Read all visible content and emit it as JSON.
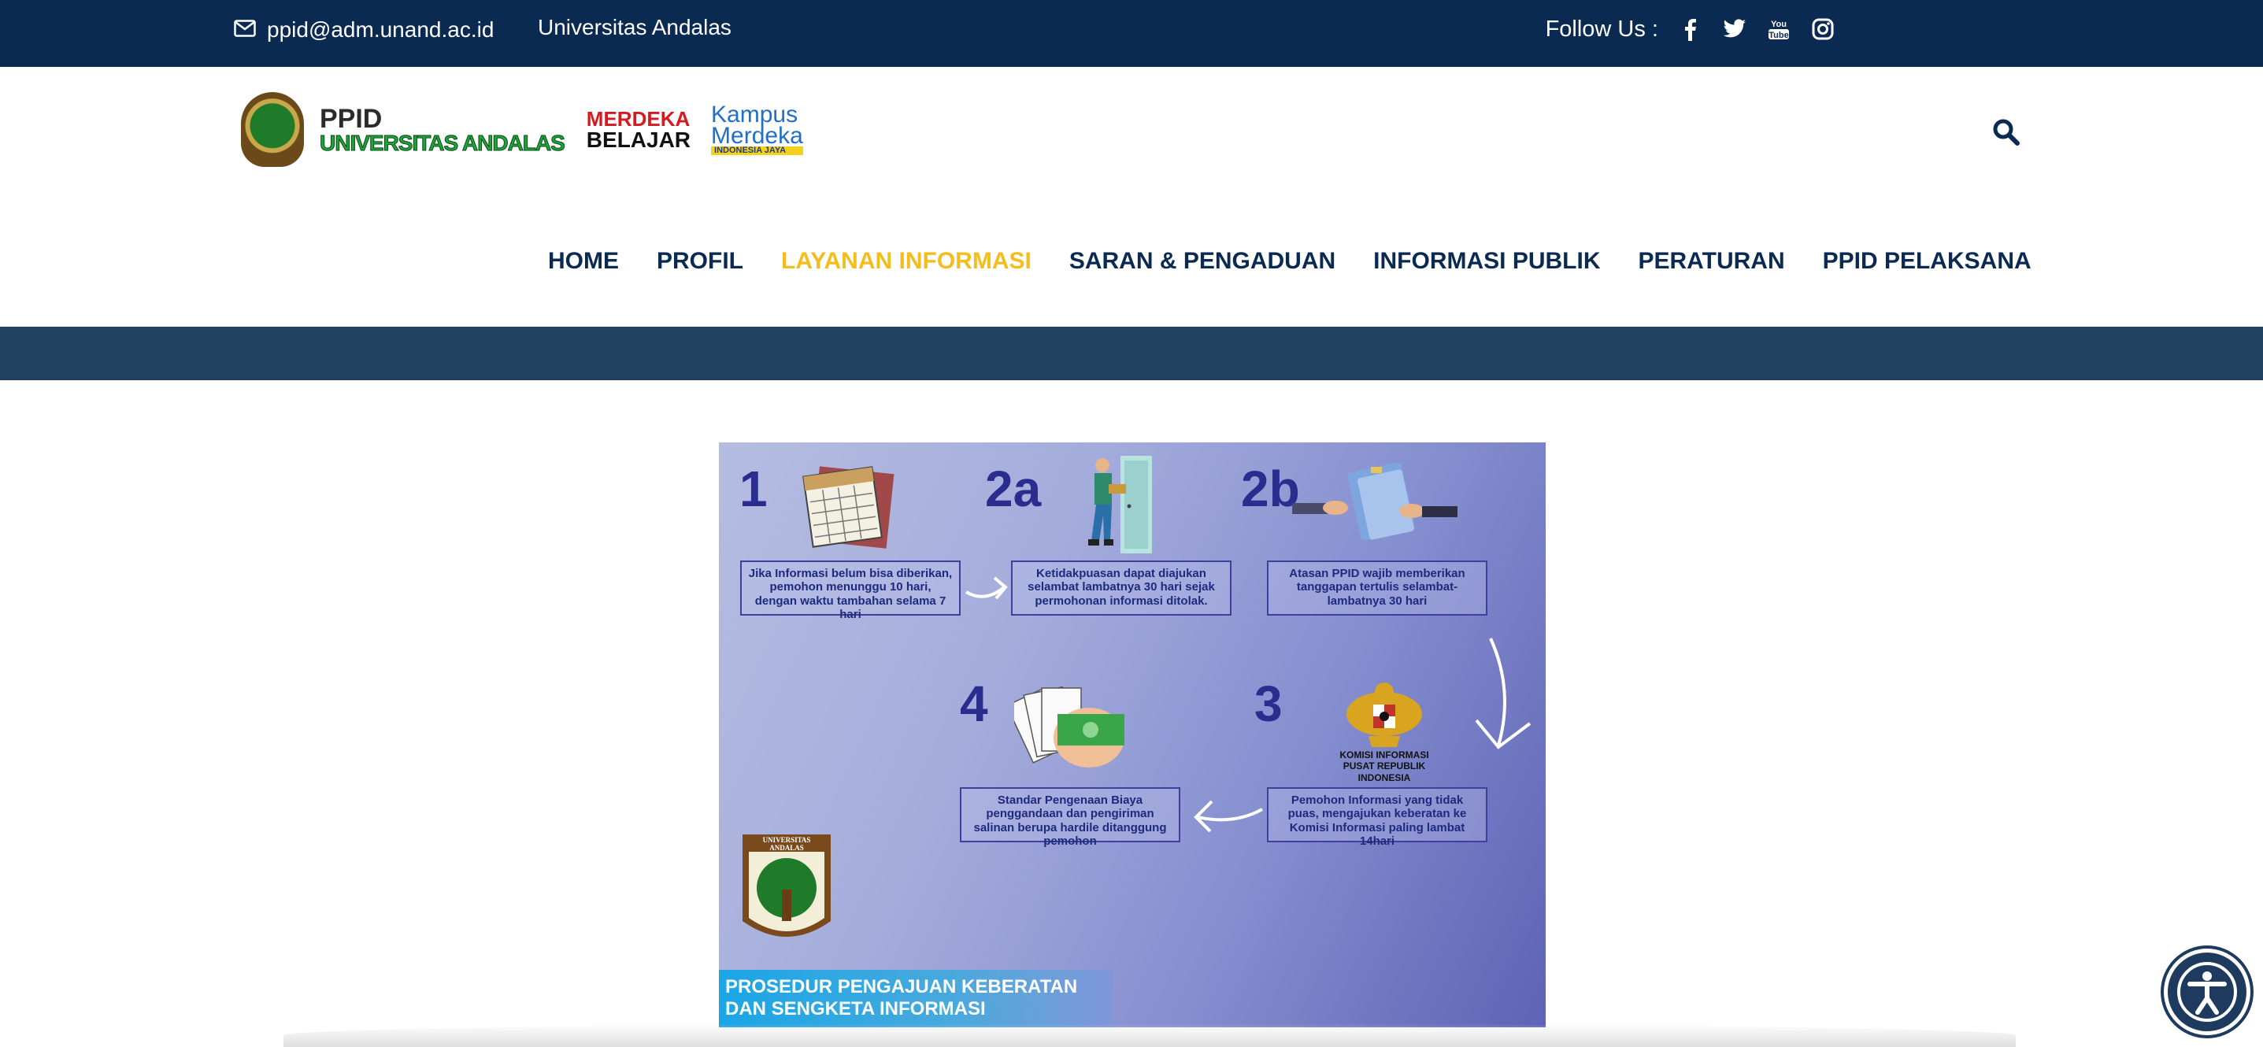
{
  "topbar": {
    "email": "ppid@adm.unand.ac.id",
    "site_name": "Universitas Andalas",
    "follow_label": "Follow Us :",
    "social": [
      "facebook-icon",
      "twitter-icon",
      "youtube-icon",
      "instagram-icon"
    ],
    "youtube_text": "You\nTube"
  },
  "header": {
    "logo_ppid": "PPID",
    "logo_univ": "UNIVERSITAS ANDALAS",
    "merdeka_1": "MERDEKA",
    "merdeka_2": "BELAJAR",
    "kampus_1": "Kampus",
    "kampus_2": "Merdeka",
    "kampus_3": "INDONESIA JAYA"
  },
  "nav": {
    "items": [
      {
        "label": "HOME",
        "active": false
      },
      {
        "label": "PROFIL",
        "active": false
      },
      {
        "label": "LAYANAN INFORMASI",
        "active": true
      },
      {
        "label": "SARAN & PENGADUAN",
        "active": false
      },
      {
        "label": "INFORMASI PUBLIK",
        "active": false
      },
      {
        "label": "PERATURAN",
        "active": false
      },
      {
        "label": "PPID PELAKSANA",
        "active": false
      }
    ]
  },
  "infographic": {
    "steps": [
      {
        "num": "1",
        "text": "Jika Informasi belum bisa diberikan, pemohon menunggu 10 hari, dengan waktu tambahan selama 7 hari"
      },
      {
        "num": "2a",
        "text": "Ketidakpuasan dapat diajukan selambat lambatnya 30 hari sejak permohonan informasi ditolak."
      },
      {
        "num": "2b",
        "text": "Atasan PPID wajib memberikan tanggapan tertulis selambat-lambatnya 30 hari"
      },
      {
        "num": "3",
        "text": "Pemohon Informasi yang tidak puas, mengajukan keberatan ke Komisi Informasi paling lambat 14hari"
      },
      {
        "num": "4",
        "text": "Standar Pengenaan Biaya penggandaan dan pengiriman salinan berupa hardile ditanggung pemohon"
      }
    ],
    "komisi_label": "KOMISI INFORMASI PUSAT REPUBLIK INDONESIA",
    "seal_label": "UNIVERSITAS ANDALAS",
    "caption_line1": "PROSEDUR PENGAJUAN KEBERATAN",
    "caption_line2": "DAN SENGKETA INFORMASI"
  },
  "colors": {
    "topbar": "#0b2a52",
    "nav_text": "#0b2a52",
    "nav_active": "#f3bd1b",
    "strip": "#22405f"
  }
}
